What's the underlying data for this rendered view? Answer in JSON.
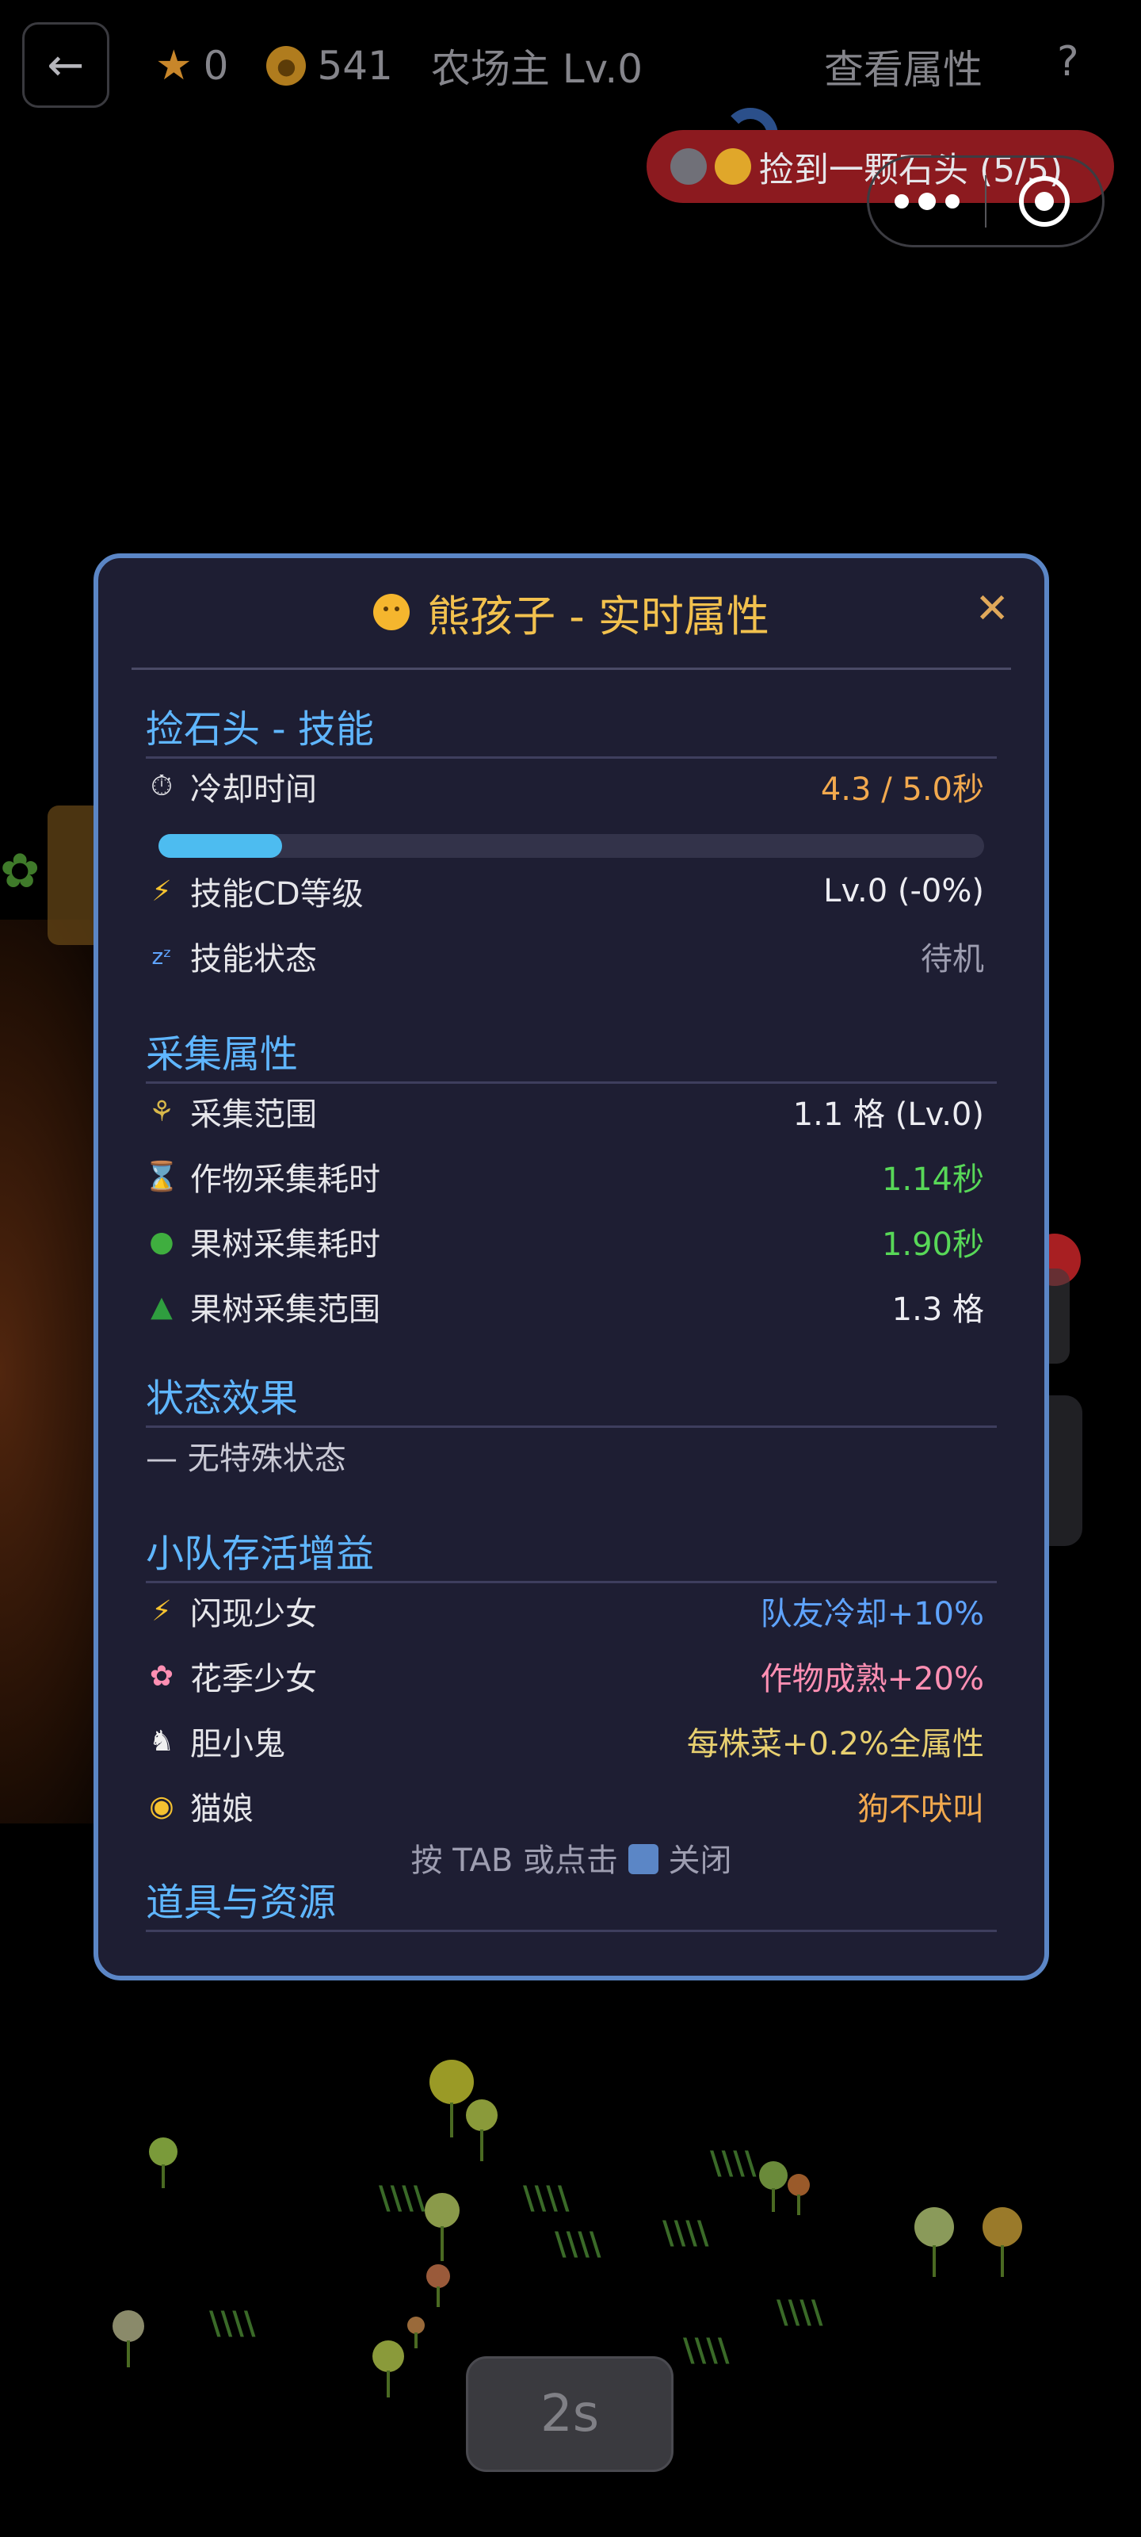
{
  "topbar": {
    "stars": "0",
    "coins": "541",
    "level": "农场主 Lv.0",
    "view_attributes": "查看属性",
    "help": "?"
  },
  "toast": {
    "text": "捡到一颗石头 (5/5)"
  },
  "timer": {
    "label": "2s"
  },
  "modal": {
    "title": "熊孩子 - 实时属性",
    "sections": {
      "skill": {
        "title": "捡石头 - 技能",
        "cooldown_label": "冷却时间",
        "cooldown_value": "4.3 / 5.0秒",
        "cooldown_progress": 0.15,
        "cd_level_label": "技能CD等级",
        "cd_level_value": "Lv.0 (-0%)",
        "status_label": "技能状态",
        "status_value": "待机"
      },
      "gather": {
        "title": "采集属性",
        "range_label": "采集范围",
        "range_value": "1.1 格 (Lv.0)",
        "crop_time_label": "作物采集耗时",
        "crop_time_value": "1.14秒",
        "tree_time_label": "果树采集耗时",
        "tree_time_value": "1.90秒",
        "tree_range_label": "果树采集范围",
        "tree_range_value": "1.3 格"
      },
      "status": {
        "title": "状态效果",
        "none_text": "— 无特殊状态"
      },
      "team": {
        "title": "小队存活增益",
        "members": [
          {
            "name": "闪现少女",
            "effect": "队友冷却+10%"
          },
          {
            "name": "花季少女",
            "effect": "作物成熟+20%"
          },
          {
            "name": "胆小鬼",
            "effect": "每株菜+0.2%全属性"
          },
          {
            "name": "猫娘",
            "effect": "狗不吠叫"
          }
        ]
      },
      "items": {
        "title": "道具与资源"
      }
    },
    "footer_prefix": "按 TAB 或点击",
    "footer_suffix": "关闭"
  },
  "colors": {
    "accent_blue": "#5fb6ff",
    "title_gold": "#f2c14e",
    "modal_border": "#5b86c6",
    "progress_fill": "#4dbcf0"
  }
}
